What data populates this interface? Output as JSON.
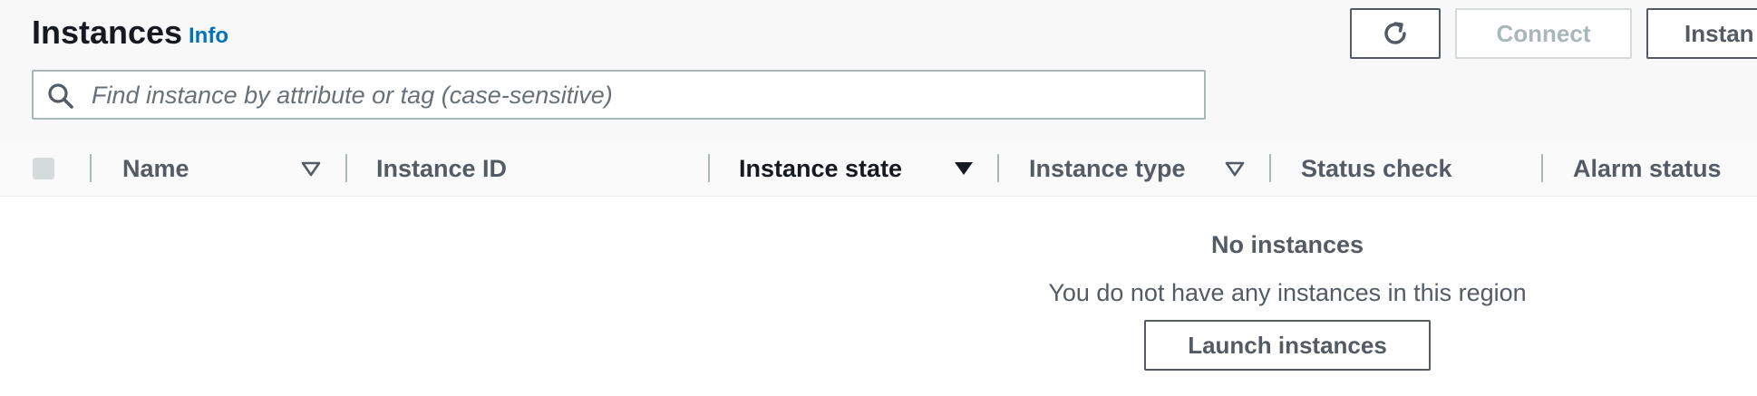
{
  "header": {
    "title": "Instances",
    "info_link": "Info",
    "actions": {
      "refresh_icon": "refresh-icon",
      "connect_label": "Connect",
      "instance_state_label": "Instan"
    }
  },
  "search": {
    "icon": "search-icon",
    "placeholder": "Find instance by attribute or tag (case-sensitive)",
    "value": ""
  },
  "table": {
    "columns": [
      {
        "label": "Name",
        "sort": "sortable"
      },
      {
        "label": "Instance ID",
        "sort": "none"
      },
      {
        "label": "Instance state",
        "sort": "sorted-descending"
      },
      {
        "label": "Instance type",
        "sort": "sortable"
      },
      {
        "label": "Status check",
        "sort": "none"
      },
      {
        "label": "Alarm status",
        "sort": "none"
      }
    ],
    "empty_state": {
      "title": "No instances",
      "message": "You do not have any instances in this region",
      "action_label": "Launch instances"
    }
  },
  "colors": {
    "link": "#0073bb",
    "text_primary": "#16191f",
    "text_secondary": "#545b64",
    "disabled": "#aab7b8"
  }
}
